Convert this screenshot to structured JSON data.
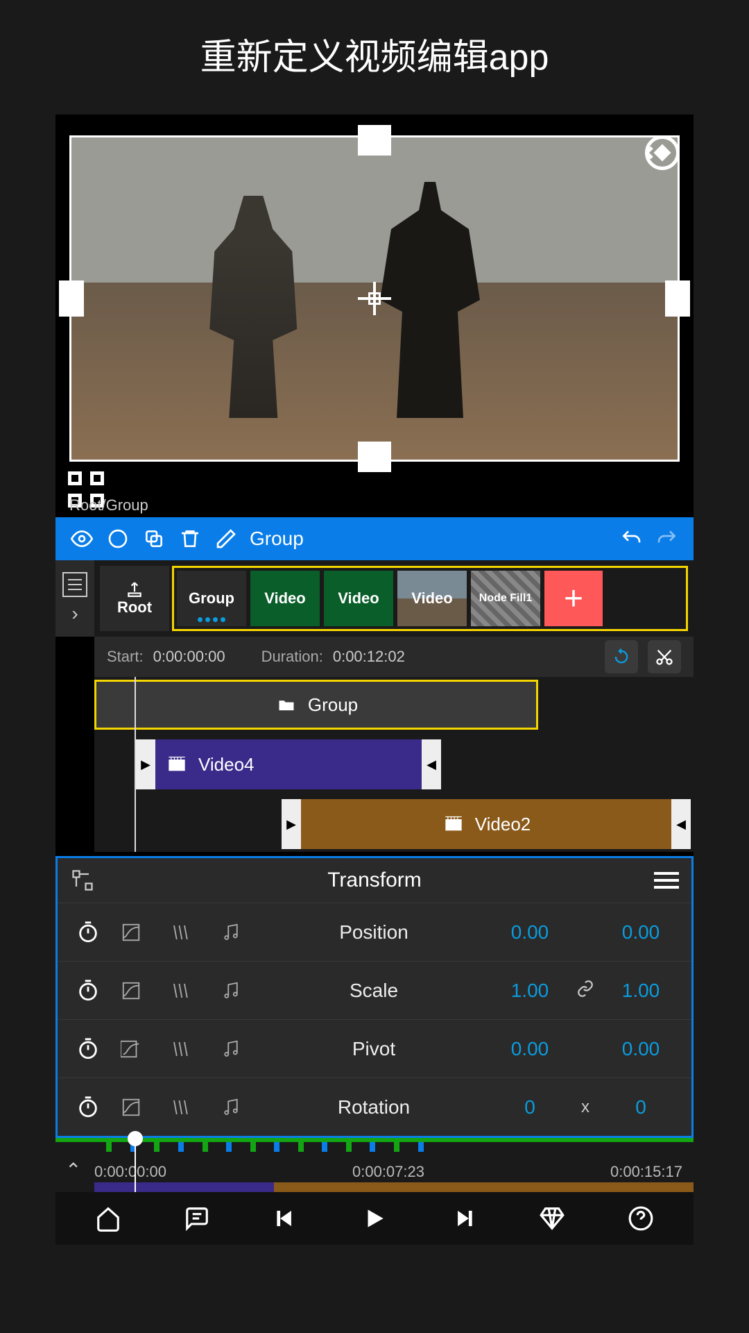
{
  "page_title": "重新定义视频编辑app",
  "breadcrumb": "Root/Group",
  "toolbar": {
    "group_label": "Group"
  },
  "root_label": "Root",
  "nodes": {
    "group": "Group",
    "video_a": "Video",
    "video_b": "Video",
    "video_c": "Video",
    "fill": "Node Fill1"
  },
  "time_info": {
    "start_label": "Start:",
    "start_value": "0:00:00:00",
    "duration_label": "Duration:",
    "duration_value": "0:00:12:02"
  },
  "clips": {
    "group": "Group",
    "video4": "Video4",
    "video2": "Video2"
  },
  "transform": {
    "title": "Transform",
    "rows": {
      "position": {
        "label": "Position",
        "v1": "0.00",
        "v2": "0.00"
      },
      "scale": {
        "label": "Scale",
        "v1": "1.00",
        "v2": "1.00"
      },
      "pivot": {
        "label": "Pivot",
        "v1": "0.00",
        "v2": "0.00"
      },
      "rotation": {
        "label": "Rotation",
        "v1": "0",
        "sep": "x",
        "v2": "0"
      }
    }
  },
  "ruler": {
    "t0": "0:00:00:00",
    "t1": "0:00:07:23",
    "t2": "0:00:15:17"
  }
}
